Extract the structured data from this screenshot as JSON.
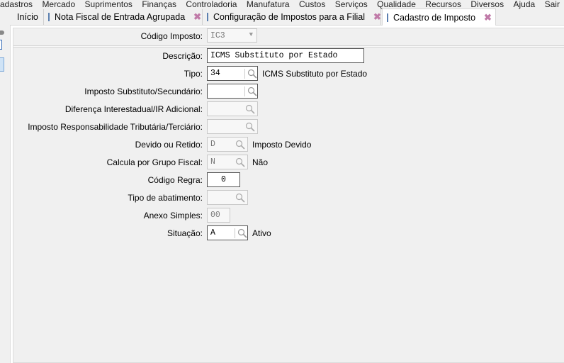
{
  "menu": [
    "adastros",
    "Mercado",
    "Suprimentos",
    "Finanças",
    "Controladoria",
    "Manufatura",
    "Custos",
    "Serviços",
    "Qualidade",
    "Recursos",
    "Diversos",
    "Ajuda",
    "Sair"
  ],
  "tabs": [
    {
      "label": "Início"
    },
    {
      "label": "Nota Fiscal de Entrada Agrupada"
    },
    {
      "label": "Configuração de Impostos para a Filial"
    },
    {
      "label": "Cadastro de Imposto"
    }
  ],
  "form": {
    "codigo_label": "Código Imposto:",
    "codigo_value": "IC3",
    "descricao_label": "Descrição:",
    "descricao_value": "ICMS Substituto por Estado",
    "tipo_label": "Tipo:",
    "tipo_value": "34",
    "tipo_desc": "ICMS Substituto por Estado",
    "substituto_label": "Imposto Substituto/Secundário:",
    "diferenca_label": "Diferença Interestadual/IR Adicional:",
    "responsabilidade_label": "Imposto Responsabilidade Tributária/Terciário:",
    "devido_label": "Devido ou Retido:",
    "devido_value": "D",
    "devido_desc": "Imposto Devido",
    "calcula_label": "Calcula por Grupo Fiscal:",
    "calcula_value": "N",
    "calcula_desc": "Não",
    "regra_label": "Código Regra:",
    "regra_value": "0",
    "abatimento_label": "Tipo de abatimento:",
    "anexo_label": "Anexo Simples:",
    "anexo_value": "00",
    "situacao_label": "Situação:",
    "situacao_value": "A",
    "situacao_desc": "Ativo"
  }
}
